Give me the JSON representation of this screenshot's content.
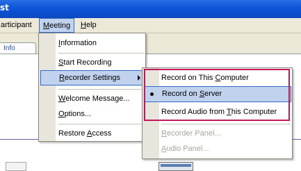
{
  "window": {
    "title_fragment": "st"
  },
  "menubar": {
    "items": [
      {
        "label": "articipant",
        "underline_index": -1
      },
      {
        "label": "Meeting",
        "underline_index": 0
      },
      {
        "label": "Help",
        "underline_index": 0
      }
    ]
  },
  "tabs": {
    "active_label": "Info"
  },
  "meeting_menu": {
    "items": [
      {
        "label": "Information",
        "underline_index": 0
      },
      {
        "label": "Start Recording",
        "underline_index": 0
      },
      {
        "label": "Recorder Settings",
        "underline_index": 0,
        "has_submenu": true,
        "highlighted": true
      },
      {
        "label": "Welcome Message...",
        "underline_index": 0
      },
      {
        "label": "Options...",
        "underline_index": 0
      },
      {
        "label": "Restore Access",
        "underline_index": 8
      }
    ]
  },
  "recorder_submenu": {
    "items": [
      {
        "label": "Record on This Computer",
        "underline_index": 15,
        "selected": false,
        "disabled": false
      },
      {
        "label": "Record on Server",
        "underline_index": 10,
        "selected": true,
        "disabled": false
      },
      {
        "label": "Record Audio from This Computer",
        "underline_index": 18,
        "selected": false,
        "disabled": false
      },
      {
        "label": "Recorder Panel...",
        "underline_index": 0,
        "disabled": true
      },
      {
        "label": "Audio Panel...",
        "underline_index": 0,
        "disabled": true
      }
    ]
  },
  "colors": {
    "titlebar": "#0a4fcf",
    "menu_highlight": "#c1d2ee",
    "menu_highlight_border": "#316ac5",
    "annotation_box": "#c2185b",
    "disabled_text": "#a7a69d"
  }
}
